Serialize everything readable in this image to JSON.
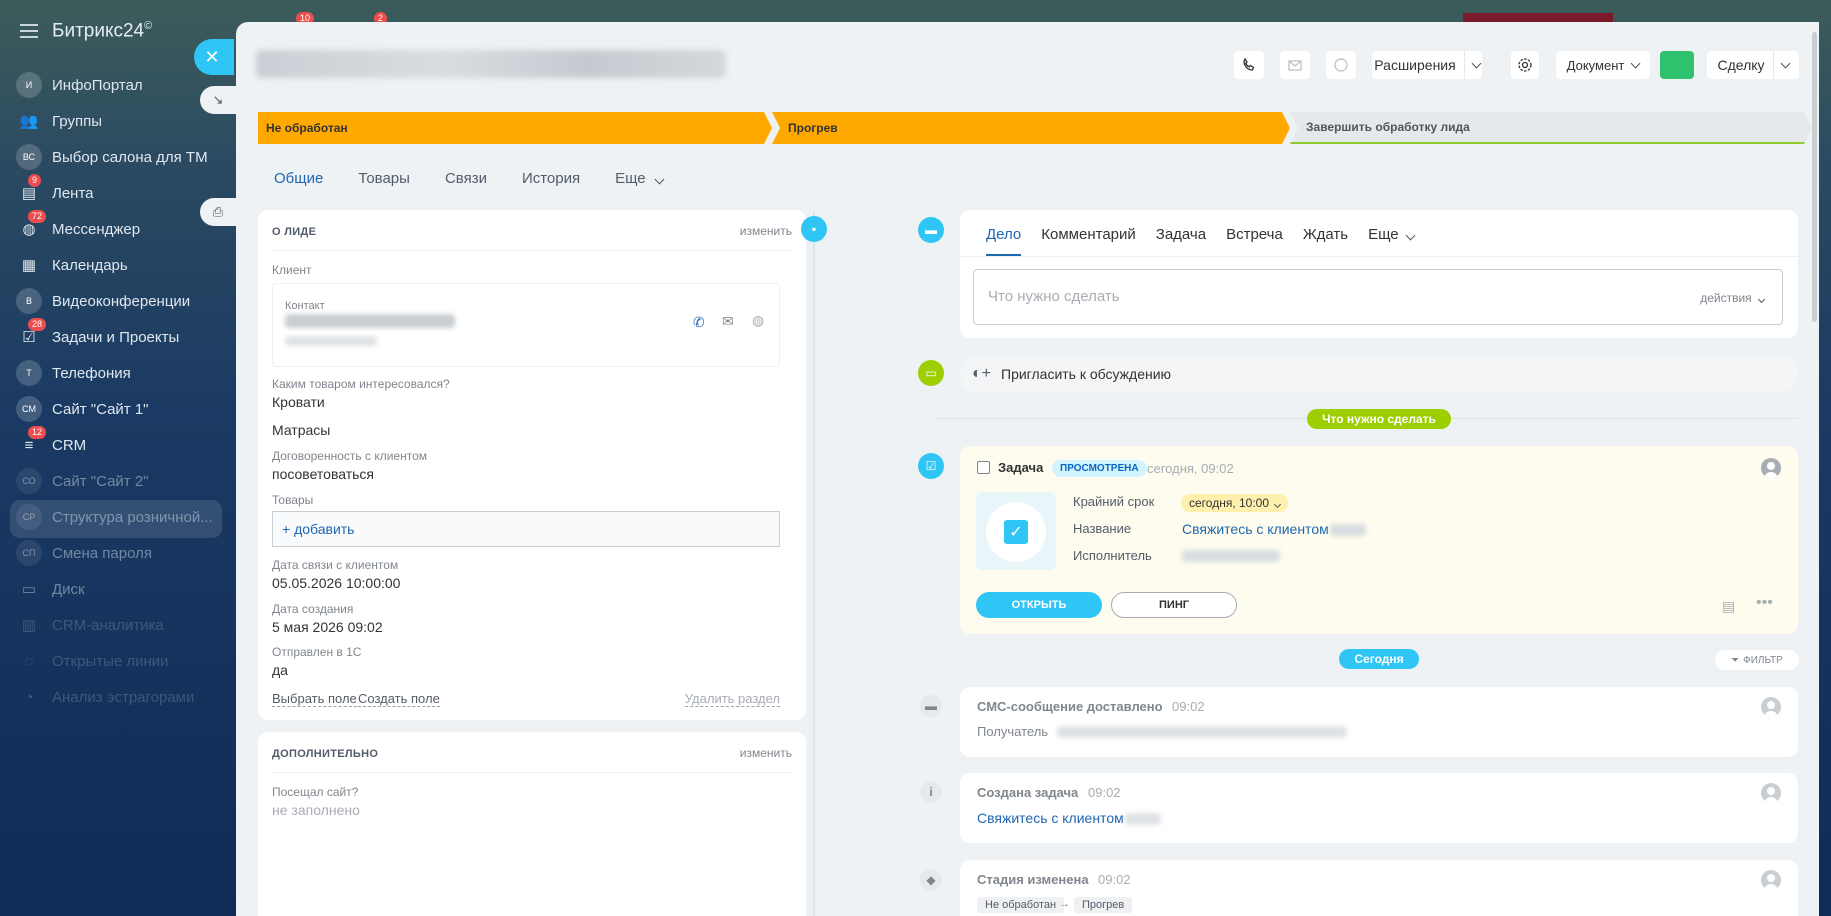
{
  "sidebar": {
    "brand": "Битрикс24",
    "brand_mark": "©",
    "items": [
      {
        "label": "ИнфоПортал",
        "icon": "И",
        "badge": ""
      },
      {
        "label": "Группы",
        "icon": "groups-icon",
        "badge": ""
      },
      {
        "label": "Выбор салона для ТМ",
        "icon": "ВС",
        "badge": ""
      },
      {
        "label": "Лента",
        "icon": "feed-icon",
        "badge": "9"
      },
      {
        "label": "Мессенджер",
        "icon": "chat-icon",
        "badge": "72"
      },
      {
        "label": "Календарь",
        "icon": "calendar-icon",
        "badge": ""
      },
      {
        "label": "Видеоконференции",
        "icon": "В",
        "badge": ""
      },
      {
        "label": "Задачи и Проекты",
        "icon": "tasks-icon",
        "badge": "28"
      },
      {
        "label": "Телефония",
        "icon": "Т",
        "badge": ""
      },
      {
        "label": "Сайт \"Сайт 1\"",
        "icon": "СМ",
        "badge": ""
      },
      {
        "label": "CRM",
        "icon": "crm-icon",
        "badge": "12"
      },
      {
        "label": "Сайт \"Сайт 2\"",
        "icon": "СО",
        "badge": ""
      },
      {
        "label": "Структура розничной...",
        "icon": "СР",
        "badge": ""
      },
      {
        "label": "Смена пароля",
        "icon": "СП",
        "badge": ""
      },
      {
        "label": "Диск",
        "icon": "disk-icon",
        "badge": ""
      },
      {
        "label": "CRM-аналитика",
        "icon": "analytics-icon",
        "badge": ""
      },
      {
        "label": "Открытые линии",
        "icon": "lines-icon",
        "badge": ""
      },
      {
        "label": "Анализ эстрагорами",
        "icon": "analysis-icon",
        "badge": ""
      }
    ]
  },
  "top_badges": [
    "10",
    "2"
  ],
  "toolbar": {
    "extensions_label": "Расширения",
    "document_label": "Документ",
    "entity_label": "Сделку",
    "accent_color": "#2fc26e"
  },
  "stages": [
    {
      "label": "Не обработан",
      "color": "#ffa900"
    },
    {
      "label": "Прогрев",
      "color": "#ffa900"
    },
    {
      "label": "Завершить обработку лида",
      "color": "#e6e9eb"
    }
  ],
  "tabs": [
    "Общие",
    "Товары",
    "Связи",
    "История",
    "Еще"
  ],
  "lead_card": {
    "title": "О ЛИДЕ",
    "edit": "изменить",
    "client_label": "Клиент",
    "contact_label": "Контакт",
    "fields": [
      {
        "label": "Каким товаром интересовался?",
        "values": [
          "Кровати",
          "Матрасы"
        ]
      },
      {
        "label": "Договоренность с клиентом",
        "values": [
          "посоветоваться"
        ]
      },
      {
        "label": "Товары",
        "values": []
      },
      {
        "label": "Дата связи с клиентом",
        "values": [
          "05.05.2026 10:00:00"
        ]
      },
      {
        "label": "Дата создания",
        "values": [
          "5 мая 2026 09:02"
        ]
      },
      {
        "label": "Отправлен в 1С",
        "values": [
          "да"
        ]
      }
    ],
    "add_product": "+ добавить",
    "select_field": "Выбрать поле",
    "create_field": "Создать поле",
    "delete_section": "Удалить раздел"
  },
  "extra_card": {
    "title": "ДОПОЛНИТЕЛЬНО",
    "edit": "изменить",
    "field_label": "Посещал сайт?",
    "field_value": "не заполнено"
  },
  "activity": {
    "tabs": [
      "Дело",
      "Комментарий",
      "Задача",
      "Встреча",
      "Ждать",
      "Еще"
    ],
    "placeholder": "Что нужно сделать",
    "actions_label": "действия",
    "invite_label": "Пригласить к обсуждению",
    "todo_pill": "Что нужно сделать"
  },
  "task": {
    "title": "Задача",
    "status": "ПРОСМОТРЕНА",
    "time": "сегодня, 09:02",
    "deadline_label": "Крайний срок",
    "deadline_value": "сегодня, 10:00",
    "name_label": "Название",
    "name_value": "Свяжитесь с клиентом",
    "assignee_label": "Исполнитель",
    "open_button": "ОТКРЫТЬ",
    "ping_button": "ПИНГ"
  },
  "today_pill": "Сегодня",
  "filter_label": "ФИЛЬТР",
  "history": [
    {
      "title": "СМС-сообщение доставлено",
      "time": "09:02",
      "label": "Получатель"
    },
    {
      "title": "Создана задача",
      "time": "09:02",
      "link": "Свяжитесь с клиентом"
    },
    {
      "title": "Стадия изменена",
      "time": "09:02",
      "from": "Не обработан",
      "arrow": "→",
      "to": "Прогрев"
    }
  ]
}
